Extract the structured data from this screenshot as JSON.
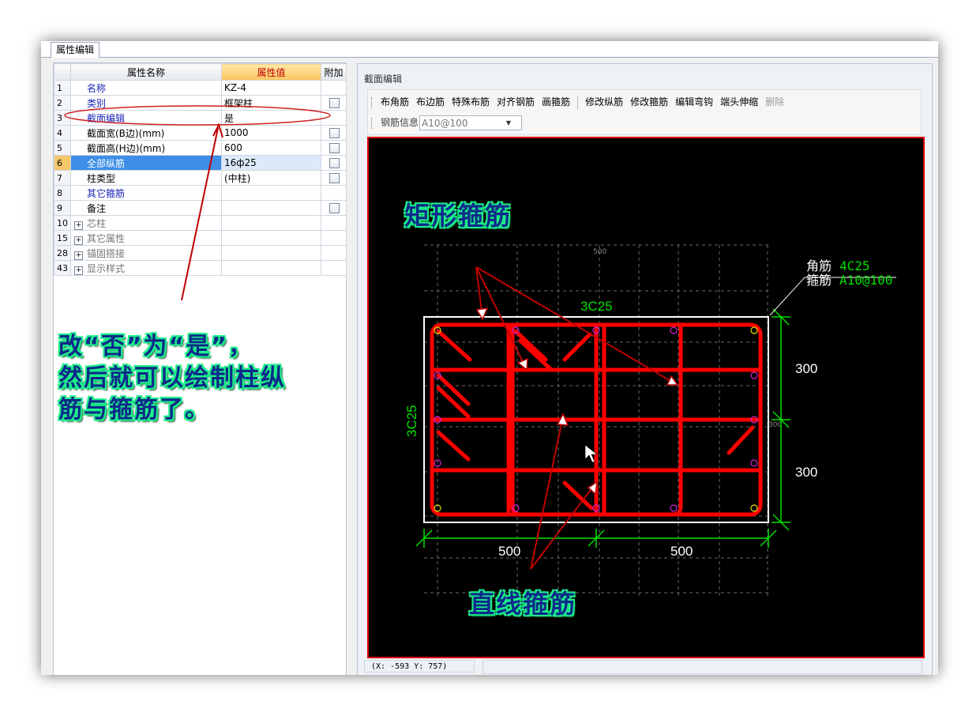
{
  "tab": {
    "label": "属性编辑"
  },
  "grid": {
    "headers": {
      "name": "属性名称",
      "value": "属性值",
      "extra": "附加"
    },
    "rows": [
      {
        "no": "1",
        "name": "名称",
        "value": "KZ-4"
      },
      {
        "no": "2",
        "name": "类别",
        "value": "框架柱"
      },
      {
        "no": "3",
        "name": "截面编辑",
        "value": "是"
      },
      {
        "no": "4",
        "name": "截面宽(B边)(mm)",
        "value": "1000"
      },
      {
        "no": "5",
        "name": "截面高(H边)(mm)",
        "value": "600"
      },
      {
        "no": "6",
        "name": "全部纵筋",
        "value": "16ф25"
      },
      {
        "no": "7",
        "name": "柱类型",
        "value": "(中柱)"
      },
      {
        "no": "8",
        "name": "其它箍筋",
        "value": ""
      },
      {
        "no": "9",
        "name": "备注",
        "value": ""
      },
      {
        "no": "10",
        "name": "芯柱",
        "value": ""
      },
      {
        "no": "15",
        "name": "其它属性",
        "value": ""
      },
      {
        "no": "28",
        "name": "锚固搭接",
        "value": ""
      },
      {
        "no": "43",
        "name": "显示样式",
        "value": ""
      }
    ]
  },
  "editor": {
    "title": "截面编辑",
    "toolbar": {
      "buttons": [
        "布角筋",
        "布边筋",
        "特殊布筋",
        "对齐钢筋",
        "画箍筋",
        "修改纵筋",
        "修改箍筋",
        "编辑弯钩",
        "端头伸缩",
        "删除"
      ],
      "rebar_info_label": "钢筋信息",
      "rebar_info_value": "A10@100"
    },
    "status": {
      "coords": "(X: -593 Y: 757)"
    }
  },
  "drawing": {
    "colors": {
      "rebar": "#ff0000",
      "dimension": "#00e000",
      "outline": "#ffffff",
      "grid": "#777777"
    },
    "top_label": "3C25",
    "left_label": "3C25",
    "corner_label_1": "角筋",
    "corner_value_1": "4C25",
    "corner_label_2": "箍筋",
    "corner_value_2": "A10@100",
    "dim_right_1": "300",
    "dim_right_2": "300",
    "dim_bottom_1": "500",
    "dim_bottom_2": "500",
    "grid_top": "500",
    "grid_right": "300"
  },
  "annotations": {
    "rect_stirrup": "矩形箍筋",
    "straight_stirrup": "直线箍筋",
    "instruction_line1": "改“否”为“是”，",
    "instruction_line2": "然后就可以绘制柱纵",
    "instruction_line3": "筋与箍筋了。",
    "annotation_color": "#0d2a8a",
    "glow_color": "#1ef08a",
    "arrow_color": "#c00000"
  }
}
